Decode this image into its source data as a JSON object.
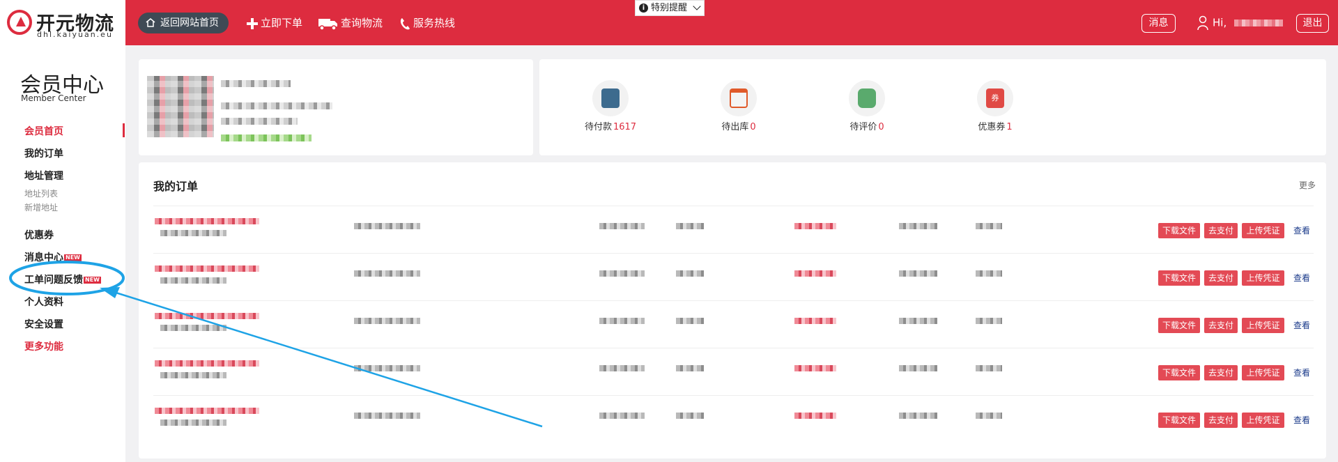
{
  "header": {
    "logo_name": "开元物流",
    "logo_sub": "dhl.kaiyuan.eu",
    "back_home": "返回网站首页",
    "nav": [
      "立即下单",
      "查询物流",
      "服务热线"
    ],
    "notice": "特别提醒",
    "messages_btn": "消息",
    "greeting": "Hi,",
    "logout_btn": "退出",
    "accent_color": "#dd2c3f"
  },
  "sidebar": {
    "title": "会员中心",
    "subtitle": "Member Center",
    "items": [
      {
        "label": "会员首页"
      },
      {
        "label": "我的订单"
      },
      {
        "label": "地址管理"
      },
      {
        "label": "地址列表"
      },
      {
        "label": "新增地址"
      },
      {
        "label": "优惠券"
      },
      {
        "label": "消息中心",
        "badge": "NEW"
      },
      {
        "label": "工单问题反馈",
        "badge": "NEW"
      },
      {
        "label": "个人资料"
      },
      {
        "label": "安全设置"
      },
      {
        "label": "更多功能"
      }
    ]
  },
  "stats": [
    {
      "label": "待付款",
      "count": "1617",
      "icon": "card-icon"
    },
    {
      "label": "待出库",
      "count": "0",
      "icon": "checklist-icon"
    },
    {
      "label": "待评价",
      "count": "0",
      "icon": "chat-icon"
    },
    {
      "label": "优惠券",
      "count": "1",
      "icon": "coupon-icon",
      "icon_text": "券"
    }
  ],
  "orders": {
    "title": "我的订单",
    "more": "更多",
    "actions": [
      "下载文件",
      "去支付",
      "上传凭证"
    ],
    "view": "查看",
    "row_count_visible": 5
  }
}
